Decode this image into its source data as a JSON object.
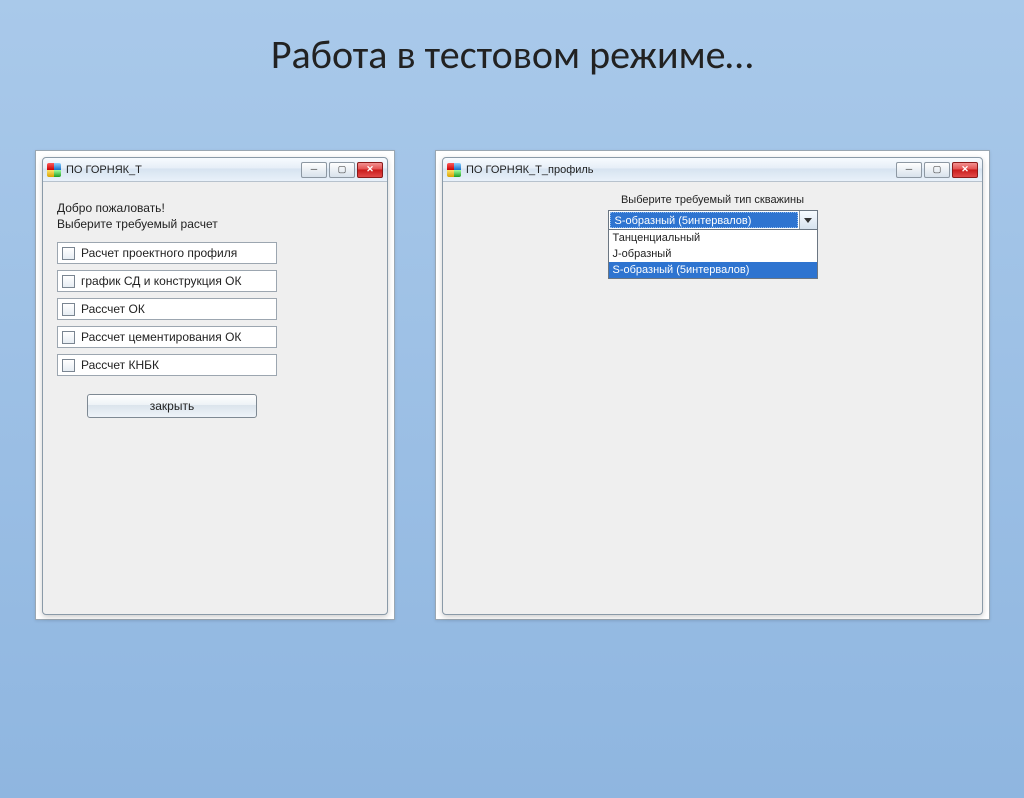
{
  "slide_title": "Работа в тестовом режиме…",
  "left_window": {
    "title": "ПО ГОРНЯК_Т",
    "welcome_line1": "Добро пожаловать!",
    "welcome_line2": "Выберите требуемый расчет",
    "options": [
      "Расчет проектного профиля",
      "график СД и конструкция ОК",
      "Рассчет ОК",
      "Рассчет цементирования ОК",
      "Рассчет КНБК"
    ],
    "close_label": "закрыть"
  },
  "right_window": {
    "title": "ПО ГОРНЯК_Т_профиль",
    "prompt": "Выберите требуемый тип скважины",
    "selected": "S-образный (5интервалов)",
    "dropdown": [
      "Танценциальный",
      "J-образный",
      "S-образный (5интервалов)"
    ],
    "highlight_index": 2
  }
}
